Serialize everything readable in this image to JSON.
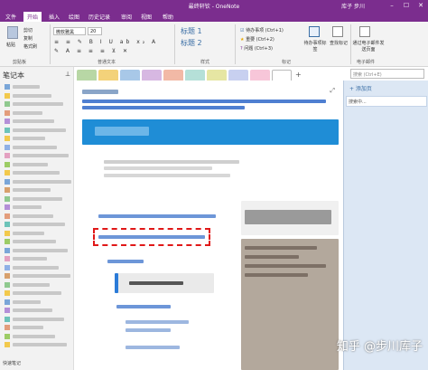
{
  "titlebar": {
    "title": "最终轩钦 - OneNote",
    "user": "库子 步川",
    "min": "–",
    "max": "☐",
    "close": "✕"
  },
  "menu": [
    "文件",
    "开始",
    "插入",
    "绘图",
    "历史记录",
    "审阅",
    "视图",
    "帮助"
  ],
  "ribbon": {
    "paste": "粘贴",
    "cut": "剪切",
    "copy": "复制",
    "format_painter": "格式刷",
    "clipboard_group": "剪贴板",
    "font_name": "微软雅黑",
    "font_size": "20",
    "basic_text_group": "普通文本",
    "style1": "标题 1",
    "style2": "标题 2",
    "styles_group": "样式",
    "tag1": "待办事项 (Ctrl+1)",
    "tag2": "重要 (Ctrl+2)",
    "tag3": "问题 (Ctrl+3)",
    "tags_group": "标记",
    "todo_tag": "待办事项标签",
    "find_tags": "查找标记",
    "email_page": "通过电子邮件发送页面",
    "email_group": "电子邮件"
  },
  "left_panel": {
    "header": "笔记本",
    "footer": "快速笔记"
  },
  "search": {
    "placeholder": "搜索 (Ctrl+E)"
  },
  "right_panel": {
    "add_page": "+ 添加页",
    "page_title": "搜索中..."
  },
  "watermark": "知乎 @步川库子"
}
